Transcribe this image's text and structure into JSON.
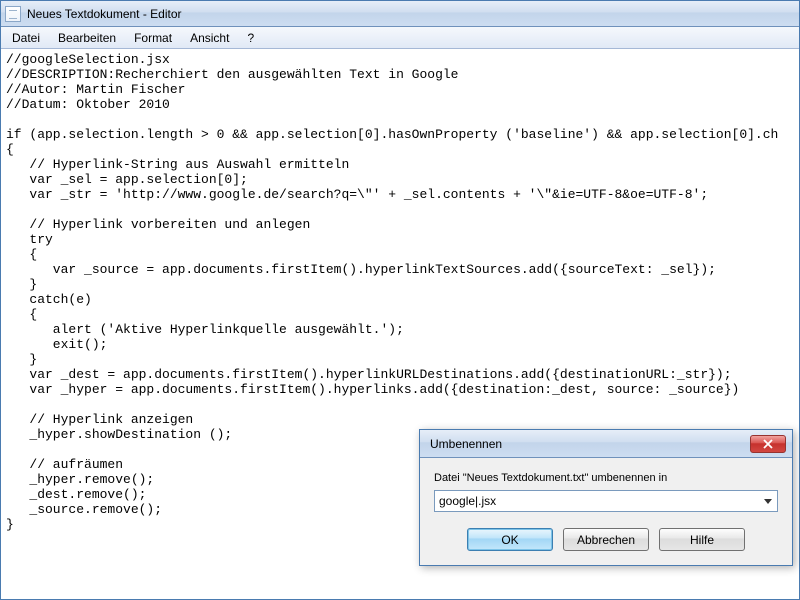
{
  "window": {
    "title": "Neues Textdokument - Editor"
  },
  "menu": {
    "file": "Datei",
    "edit": "Bearbeiten",
    "format": "Format",
    "view": "Ansicht",
    "help": "?"
  },
  "editor": {
    "content": "//googleSelection.jsx\n//DESCRIPTION:Recherchiert den ausgewählten Text in Google\n//Autor: Martin Fischer\n//Datum: Oktober 2010\n\nif (app.selection.length > 0 && app.selection[0].hasOwnProperty ('baseline') && app.selection[0].ch\n{\n   // Hyperlink-String aus Auswahl ermitteln\n   var _sel = app.selection[0];\n   var _str = 'http://www.google.de/search?q=\\\"' + _sel.contents + '\\\"&ie=UTF-8&oe=UTF-8';\n\n   // Hyperlink vorbereiten und anlegen\n   try\n   {\n      var _source = app.documents.firstItem().hyperlinkTextSources.add({sourceText: _sel});\n   }\n   catch(e)\n   {\n      alert ('Aktive Hyperlinkquelle ausgewählt.');\n      exit();\n   }\n   var _dest = app.documents.firstItem().hyperlinkURLDestinations.add({destinationURL:_str});\n   var _hyper = app.documents.firstItem().hyperlinks.add({destination:_dest, source: _source})\n\n   // Hyperlink anzeigen\n   _hyper.showDestination ();\n\n   // aufräumen\n   _hyper.remove();\n   _dest.remove();\n   _source.remove();\n}"
  },
  "dialog": {
    "title": "Umbenennen",
    "label": "Datei \"Neues Textdokument.txt\" umbenennen in",
    "value": "google|.jsx",
    "ok": "OK",
    "cancel": "Abbrechen",
    "help": "Hilfe"
  }
}
